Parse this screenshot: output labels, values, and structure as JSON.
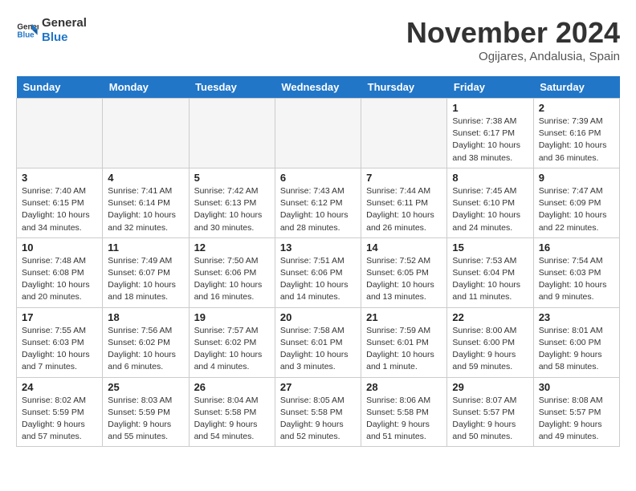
{
  "header": {
    "logo_line1": "General",
    "logo_line2": "Blue",
    "title": "November 2024",
    "subtitle": "Ogijares, Andalusia, Spain"
  },
  "columns": [
    "Sunday",
    "Monday",
    "Tuesday",
    "Wednesday",
    "Thursday",
    "Friday",
    "Saturday"
  ],
  "weeks": [
    [
      {
        "day": "",
        "info": ""
      },
      {
        "day": "",
        "info": ""
      },
      {
        "day": "",
        "info": ""
      },
      {
        "day": "",
        "info": ""
      },
      {
        "day": "",
        "info": ""
      },
      {
        "day": "1",
        "info": "Sunrise: 7:38 AM\nSunset: 6:17 PM\nDaylight: 10 hours\nand 38 minutes."
      },
      {
        "day": "2",
        "info": "Sunrise: 7:39 AM\nSunset: 6:16 PM\nDaylight: 10 hours\nand 36 minutes."
      }
    ],
    [
      {
        "day": "3",
        "info": "Sunrise: 7:40 AM\nSunset: 6:15 PM\nDaylight: 10 hours\nand 34 minutes."
      },
      {
        "day": "4",
        "info": "Sunrise: 7:41 AM\nSunset: 6:14 PM\nDaylight: 10 hours\nand 32 minutes."
      },
      {
        "day": "5",
        "info": "Sunrise: 7:42 AM\nSunset: 6:13 PM\nDaylight: 10 hours\nand 30 minutes."
      },
      {
        "day": "6",
        "info": "Sunrise: 7:43 AM\nSunset: 6:12 PM\nDaylight: 10 hours\nand 28 minutes."
      },
      {
        "day": "7",
        "info": "Sunrise: 7:44 AM\nSunset: 6:11 PM\nDaylight: 10 hours\nand 26 minutes."
      },
      {
        "day": "8",
        "info": "Sunrise: 7:45 AM\nSunset: 6:10 PM\nDaylight: 10 hours\nand 24 minutes."
      },
      {
        "day": "9",
        "info": "Sunrise: 7:47 AM\nSunset: 6:09 PM\nDaylight: 10 hours\nand 22 minutes."
      }
    ],
    [
      {
        "day": "10",
        "info": "Sunrise: 7:48 AM\nSunset: 6:08 PM\nDaylight: 10 hours\nand 20 minutes."
      },
      {
        "day": "11",
        "info": "Sunrise: 7:49 AM\nSunset: 6:07 PM\nDaylight: 10 hours\nand 18 minutes."
      },
      {
        "day": "12",
        "info": "Sunrise: 7:50 AM\nSunset: 6:06 PM\nDaylight: 10 hours\nand 16 minutes."
      },
      {
        "day": "13",
        "info": "Sunrise: 7:51 AM\nSunset: 6:06 PM\nDaylight: 10 hours\nand 14 minutes."
      },
      {
        "day": "14",
        "info": "Sunrise: 7:52 AM\nSunset: 6:05 PM\nDaylight: 10 hours\nand 13 minutes."
      },
      {
        "day": "15",
        "info": "Sunrise: 7:53 AM\nSunset: 6:04 PM\nDaylight: 10 hours\nand 11 minutes."
      },
      {
        "day": "16",
        "info": "Sunrise: 7:54 AM\nSunset: 6:03 PM\nDaylight: 10 hours\nand 9 minutes."
      }
    ],
    [
      {
        "day": "17",
        "info": "Sunrise: 7:55 AM\nSunset: 6:03 PM\nDaylight: 10 hours\nand 7 minutes."
      },
      {
        "day": "18",
        "info": "Sunrise: 7:56 AM\nSunset: 6:02 PM\nDaylight: 10 hours\nand 6 minutes."
      },
      {
        "day": "19",
        "info": "Sunrise: 7:57 AM\nSunset: 6:02 PM\nDaylight: 10 hours\nand 4 minutes."
      },
      {
        "day": "20",
        "info": "Sunrise: 7:58 AM\nSunset: 6:01 PM\nDaylight: 10 hours\nand 3 minutes."
      },
      {
        "day": "21",
        "info": "Sunrise: 7:59 AM\nSunset: 6:01 PM\nDaylight: 10 hours\nand 1 minute."
      },
      {
        "day": "22",
        "info": "Sunrise: 8:00 AM\nSunset: 6:00 PM\nDaylight: 9 hours\nand 59 minutes."
      },
      {
        "day": "23",
        "info": "Sunrise: 8:01 AM\nSunset: 6:00 PM\nDaylight: 9 hours\nand 58 minutes."
      }
    ],
    [
      {
        "day": "24",
        "info": "Sunrise: 8:02 AM\nSunset: 5:59 PM\nDaylight: 9 hours\nand 57 minutes."
      },
      {
        "day": "25",
        "info": "Sunrise: 8:03 AM\nSunset: 5:59 PM\nDaylight: 9 hours\nand 55 minutes."
      },
      {
        "day": "26",
        "info": "Sunrise: 8:04 AM\nSunset: 5:58 PM\nDaylight: 9 hours\nand 54 minutes."
      },
      {
        "day": "27",
        "info": "Sunrise: 8:05 AM\nSunset: 5:58 PM\nDaylight: 9 hours\nand 52 minutes."
      },
      {
        "day": "28",
        "info": "Sunrise: 8:06 AM\nSunset: 5:58 PM\nDaylight: 9 hours\nand 51 minutes."
      },
      {
        "day": "29",
        "info": "Sunrise: 8:07 AM\nSunset: 5:57 PM\nDaylight: 9 hours\nand 50 minutes."
      },
      {
        "day": "30",
        "info": "Sunrise: 8:08 AM\nSunset: 5:57 PM\nDaylight: 9 hours\nand 49 minutes."
      }
    ]
  ]
}
